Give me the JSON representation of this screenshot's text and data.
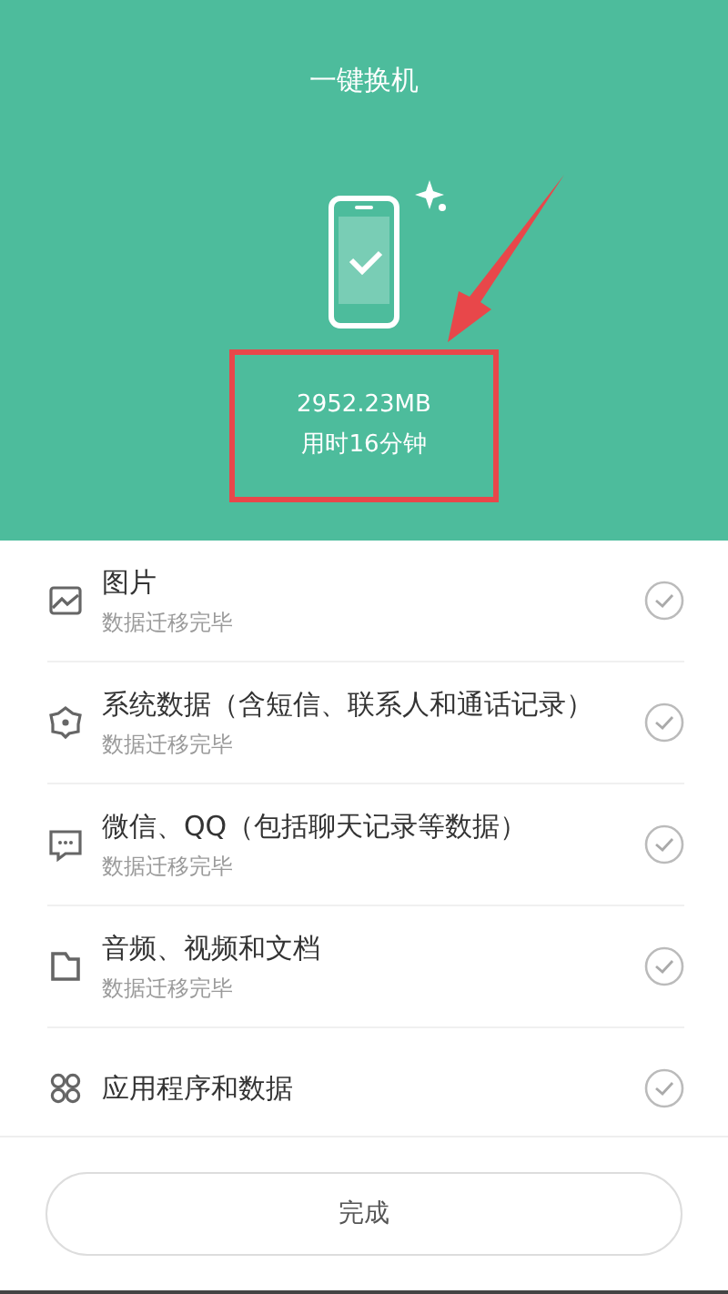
{
  "header": {
    "title": "一键换机",
    "size": "2952.23MB",
    "duration": "用时16分钟",
    "highlighted": true
  },
  "items": [
    {
      "kind": "image",
      "title": "图片",
      "subtitle": "数据迁移完毕",
      "done": true
    },
    {
      "kind": "system",
      "title": "系统数据（含短信、联系人和通话记录）",
      "subtitle": "数据迁移完毕",
      "done": true
    },
    {
      "kind": "chat",
      "title": "微信、QQ（包括聊天记录等数据）",
      "subtitle": "数据迁移完毕",
      "done": true
    },
    {
      "kind": "folder",
      "title": "音频、视频和文档",
      "subtitle": "数据迁移完毕",
      "done": true
    },
    {
      "kind": "apps",
      "title": "应用程序和数据",
      "done": true
    }
  ],
  "button": "完成"
}
